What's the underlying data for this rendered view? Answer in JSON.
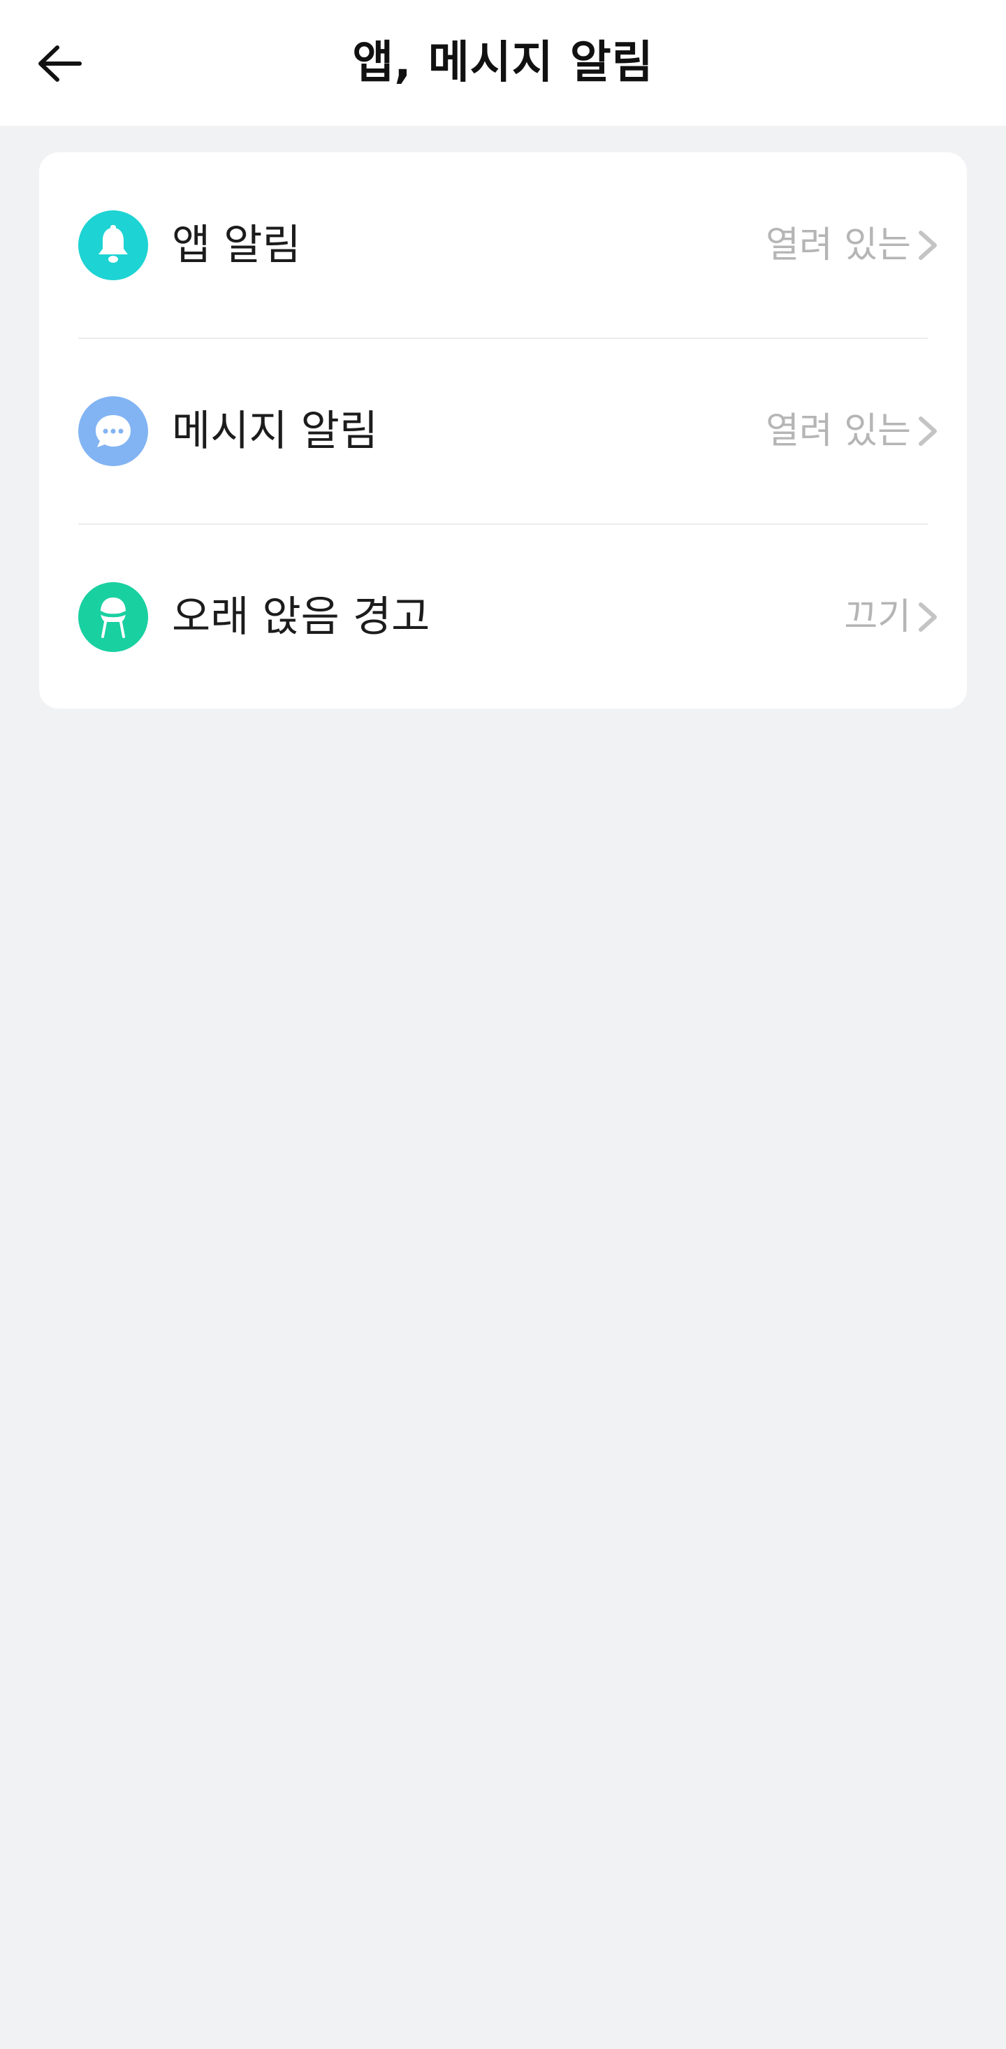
{
  "header": {
    "title": "앱, 메시지 알림",
    "back_icon": "arrow-left-icon"
  },
  "settings": {
    "items": [
      {
        "label": "앱 알림",
        "value": "열려 있는",
        "icon": "bell-icon",
        "icon_color": "#1dd3d3"
      },
      {
        "label": "메시지 알림",
        "value": "열려 있는",
        "icon": "chat-bubble-icon",
        "icon_color": "#82b4f3"
      },
      {
        "label": "오래 앉음 경고",
        "value": "끄기",
        "icon": "chair-icon",
        "icon_color": "#19d0a1"
      }
    ]
  },
  "colors": {
    "background": "#f1f2f4",
    "card": "#ffffff",
    "secondary_text": "#b5b5b5",
    "primary_text": "#1c1c1c"
  }
}
